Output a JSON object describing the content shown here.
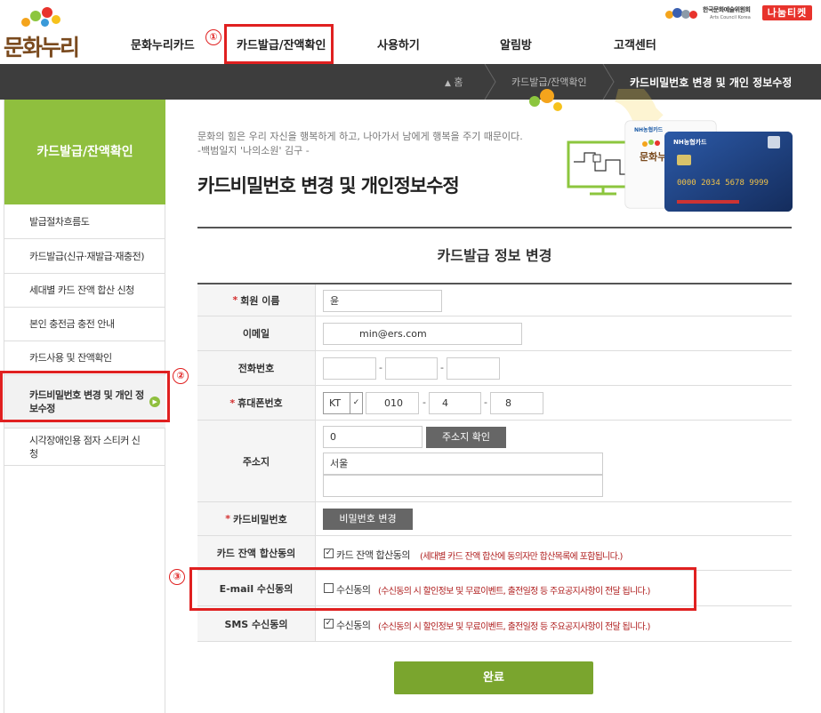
{
  "brand": {
    "logo_text": "문화누리",
    "arts_council_kr": "한국문화예술위원회",
    "arts_council_en": "Arts Council Korea",
    "nanum_ticket": "나눔티켓"
  },
  "gnb": {
    "items": [
      "문화누리카드",
      "카드발급/잔액확인",
      "사용하기",
      "알림방",
      "고객센터"
    ]
  },
  "annotations": [
    "①",
    "②",
    "③"
  ],
  "breadcrumb": {
    "home": "홈",
    "section": "카드발급/잔액확인",
    "current": "카드비밀번호 변경 및 개인 정보수정"
  },
  "sidebar": {
    "title": "카드발급/잔액확인",
    "items": [
      "발급절차흐름도",
      "카드발급(신규·재발급·재충전)",
      "세대별 카드 잔액 합산 신청",
      "본인 충전금 충전 안내",
      "카드사용 및 잔액확인",
      "카드비밀번호 변경 및 개인 정보수정",
      "시각장애인용 점자 스티커 신청"
    ]
  },
  "main": {
    "quote_line1": "문화의 힘은 우리 자신을 행복하게 하고, 나아가서 남에게 행복을 주기 때문이다.",
    "quote_line2": "-백범일지 '나의소원' 김구 -",
    "title": "카드비밀번호 변경 및 개인정보수정"
  },
  "cards": {
    "bank": "NH농협카드",
    "card_number": "0000 2034 5678 9999"
  },
  "form": {
    "title": "카드발급 정보 변경",
    "required_mark": "*",
    "name": {
      "label": "회원 이름",
      "value": "윤"
    },
    "email": {
      "label": "이메일",
      "value": "min@ers.com"
    },
    "phone": {
      "label": "전화번호",
      "parts": [
        "",
        "",
        ""
      ]
    },
    "mobile": {
      "label": "휴대폰번호",
      "carrier": "KT",
      "parts": [
        "010",
        "4",
        "8"
      ]
    },
    "address": {
      "label": "주소지",
      "zipcode": "0",
      "zip_button": "주소지 확인",
      "addr1": "서울",
      "addr2": ""
    },
    "password": {
      "label": "카드비밀번호",
      "button": "비밀번호 변경"
    },
    "balance": {
      "label": "카드 잔액 합산동의",
      "checkbox": "카드 잔액 합산동의",
      "checked": true,
      "note": "(세대별 카드 잔액 합산에 동의자만 합산목록에 포함됩니다.)"
    },
    "email_consent": {
      "label": "E-mail 수신동의",
      "checkbox": "수신동의",
      "checked": false,
      "note": "(수신동의 시 할인정보 및 무료이벤트, 출전일정 등 주요공지사항이 전달 됩니다.)"
    },
    "sms_consent": {
      "label": "SMS 수신동의",
      "checkbox": "수신동의",
      "checked": true,
      "note": "(수신동의 시 할인정보 및 무료이벤트, 출전일정 등 주요공지사항이 전달 됩니다.)"
    },
    "submit": "완료"
  },
  "colors": {
    "green": "#8fbf3e",
    "dark_bar": "#3d3d3d",
    "annotation_red": "#e02020",
    "note_red": "#b02020"
  }
}
